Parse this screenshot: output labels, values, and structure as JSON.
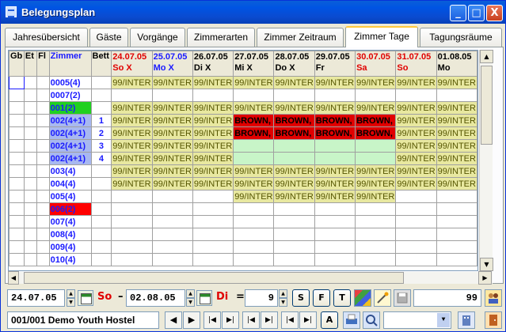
{
  "window": {
    "title": "Belegungsplan",
    "buttons": [
      "_",
      "□",
      "X"
    ]
  },
  "tabs": [
    {
      "label": "Jahresübersicht",
      "active": false
    },
    {
      "label": "Gäste",
      "active": false
    },
    {
      "label": "Vorgänge",
      "active": false
    },
    {
      "label": "Zimmerarten",
      "active": false
    },
    {
      "label": "Zimmer Zeitraum",
      "active": false
    },
    {
      "label": "Zimmer Tage",
      "active": true
    },
    {
      "label": "Tagungsräume",
      "active": false
    }
  ],
  "grid": {
    "columns": {
      "gb": "Gb",
      "et": "Et",
      "fl": "Fl",
      "room": "Zimmer",
      "bed": "Bett"
    },
    "days": [
      {
        "date": "24.07.05",
        "day": "So X",
        "color": "#e00000"
      },
      {
        "date": "25.07.05",
        "day": "Mo X",
        "color": "#1a1aff"
      },
      {
        "date": "26.07.05",
        "day": "Di X",
        "color": "#000000"
      },
      {
        "date": "27.07.05",
        "day": "Mi X",
        "color": "#000000"
      },
      {
        "date": "28.07.05",
        "day": "Do X",
        "color": "#000000"
      },
      {
        "date": "29.07.05",
        "day": "Fr",
        "color": "#000000"
      },
      {
        "date": "30.07.05",
        "day": "Sa",
        "color": "#e00000"
      },
      {
        "date": "31.07.05",
        "day": "So",
        "color": "#e00000"
      },
      {
        "date": "01.08.05",
        "day": "Mo",
        "color": "#000000"
      }
    ],
    "rows": [
      {
        "room": "0005(4)",
        "roomBg": "",
        "bed": "",
        "cells": [
          "bk",
          "bk",
          "bk",
          "bk",
          "bk",
          "bk",
          "bk",
          "bk",
          "bk"
        ]
      },
      {
        "room": "0007(2)",
        "roomBg": "",
        "bed": "",
        "cells": [
          "",
          "",
          "",
          "",
          "",
          "",
          "",
          "",
          ""
        ]
      },
      {
        "room": "001(2)",
        "roomBg": "#20d020",
        "bed": "",
        "cells": [
          "bk",
          "bk",
          "bk",
          "bk",
          "bk",
          "bk",
          "bk",
          "bk",
          "bk"
        ]
      },
      {
        "room": "002(4+1)",
        "roomBg": "#a8b8f0",
        "bed": "1",
        "cells": [
          "bk",
          "bk",
          "bk",
          "brown",
          "brown",
          "brown",
          "brown",
          "bk",
          "bk"
        ]
      },
      {
        "room": "002(4+1)",
        "roomBg": "#a8b8f0",
        "bed": "2",
        "cells": [
          "bk",
          "bk",
          "bk",
          "brown",
          "brown",
          "brown",
          "brown",
          "bk",
          "bk"
        ]
      },
      {
        "room": "002(4+1)",
        "roomBg": "#a8b8f0",
        "bed": "3",
        "cells": [
          "bk",
          "bk",
          "bk",
          "free",
          "free",
          "free",
          "free",
          "bk",
          "bk"
        ]
      },
      {
        "room": "002(4+1)",
        "roomBg": "#a8b8f0",
        "bed": "4",
        "cells": [
          "bk",
          "bk",
          "bk",
          "free",
          "free",
          "free",
          "free",
          "bk",
          "bk"
        ]
      },
      {
        "room": "003(4)",
        "roomBg": "",
        "bed": "",
        "cells": [
          "bk",
          "bk",
          "bk",
          "bk",
          "bk",
          "bk",
          "bk",
          "bk",
          "bk"
        ]
      },
      {
        "room": "004(4)",
        "roomBg": "",
        "bed": "",
        "cells": [
          "bk",
          "bk",
          "bk",
          "bk",
          "bk",
          "bk",
          "bk",
          "bk",
          "bk"
        ]
      },
      {
        "room": "005(4)",
        "roomBg": "",
        "bed": "",
        "cells": [
          "",
          "",
          "",
          "bk",
          "bk",
          "bk",
          "bk",
          "",
          ""
        ]
      },
      {
        "room": "006(2)",
        "roomBg": "#ff0000",
        "bed": "",
        "cells": [
          "",
          "",
          "",
          "",
          "",
          "",
          "",
          "",
          ""
        ]
      },
      {
        "room": "007(4)",
        "roomBg": "",
        "bed": "",
        "cells": [
          "",
          "",
          "",
          "",
          "",
          "",
          "",
          "",
          ""
        ]
      },
      {
        "room": "008(4)",
        "roomBg": "",
        "bed": "",
        "cells": [
          "",
          "",
          "",
          "",
          "",
          "",
          "",
          "",
          ""
        ]
      },
      {
        "room": "009(4)",
        "roomBg": "",
        "bed": "",
        "cells": [
          "",
          "",
          "",
          "",
          "",
          "",
          "",
          "",
          ""
        ]
      },
      {
        "room": "010(4)",
        "roomBg": "",
        "bed": "",
        "cells": [
          "",
          "",
          "",
          "",
          "",
          "",
          "",
          "",
          ""
        ]
      }
    ],
    "bookingText": "99/INTER",
    "brownText": "BROWN,"
  },
  "toolbar": {
    "startDate": "24.07.05",
    "startDay": "So",
    "dash": "–",
    "endDate": "02.08.05",
    "endDay": "Di",
    "equals": "=",
    "dayCount": "9",
    "btnS": "S",
    "btnF": "F",
    "btnT": "T",
    "rightValue": "99",
    "hotel": "001/001 Demo Youth Hostel",
    "btnA": "A"
  }
}
